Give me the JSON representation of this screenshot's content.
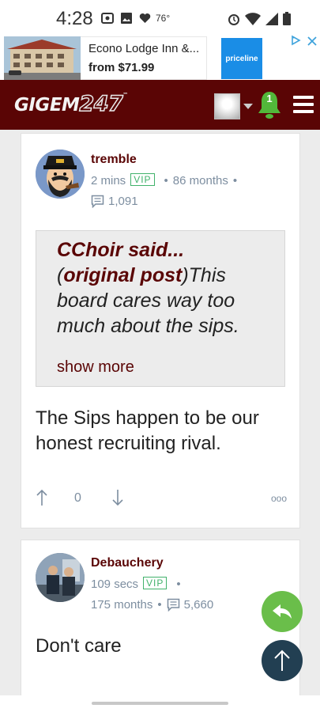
{
  "status_bar": {
    "time": "4:28",
    "temperature": "76°"
  },
  "ad": {
    "title": "Econo Lodge Inn &...",
    "price": "from $71.99",
    "brand": "priceline"
  },
  "header": {
    "logo_prefix": "GIGEM",
    "logo_number": "247",
    "logo_tm": "™",
    "notification_count": "1"
  },
  "posts": [
    {
      "author": "tremble",
      "time": "2 mins",
      "badge": "VIP",
      "tenure": "86 months",
      "post_count": "1,091",
      "quote": {
        "who": "CChoir said...",
        "open_paren": "(",
        "link": "original post",
        "close_paren": ")",
        "text": "This board cares way too much about the sips.",
        "show_more": "show more"
      },
      "body": "The Sips happen to be our honest recruiting rival.",
      "votes": "0",
      "more": "ooo"
    },
    {
      "author": "Debauchery",
      "time": "109 secs",
      "badge": "VIP",
      "tenure": "175 months",
      "post_count": "5,660",
      "body": "Don't care"
    }
  ],
  "colors": {
    "brand": "#5a0505",
    "vip": "#41b26b",
    "meta": "#7d8ea0",
    "reply_fab": "#6abe4a",
    "top_fab": "#223f52"
  }
}
